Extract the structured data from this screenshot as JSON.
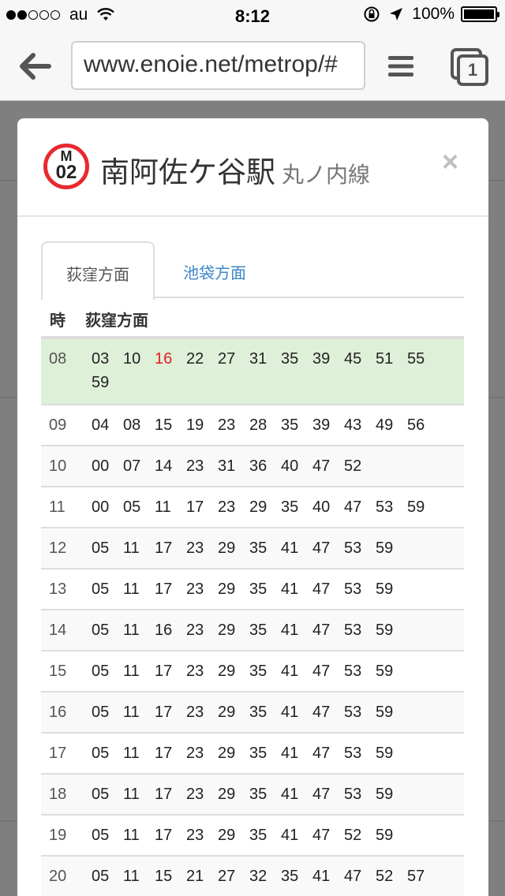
{
  "status_bar": {
    "carrier": "au",
    "time": "8:12",
    "battery": "100%"
  },
  "browser": {
    "url": "www.enoie.net/metrop/#",
    "tab_count": "1"
  },
  "modal": {
    "line_logo_letter": "M",
    "line_logo_number": "02",
    "line_color": "#e8292f",
    "station_name": "南阿佐ケ谷駅",
    "line_name": "丸ノ内線",
    "close_symbol": "×",
    "tabs": [
      {
        "label": "荻窪方面",
        "active": true
      },
      {
        "label": "池袋方面",
        "active": false
      }
    ],
    "table": {
      "col_hour": "時",
      "col_direction": "荻窪方面",
      "rows": [
        {
          "hour": "08",
          "minutes": [
            "03",
            "10",
            "16",
            "22",
            "27",
            "31",
            "35",
            "39",
            "45",
            "51",
            "55",
            "59"
          ],
          "highlight_minute": "16"
        },
        {
          "hour": "09",
          "minutes": [
            "04",
            "08",
            "15",
            "19",
            "23",
            "28",
            "35",
            "39",
            "43",
            "49",
            "56"
          ]
        },
        {
          "hour": "10",
          "minutes": [
            "00",
            "07",
            "14",
            "23",
            "31",
            "36",
            "40",
            "47",
            "52"
          ]
        },
        {
          "hour": "11",
          "minutes": [
            "00",
            "05",
            "11",
            "17",
            "23",
            "29",
            "35",
            "40",
            "47",
            "53",
            "59"
          ]
        },
        {
          "hour": "12",
          "minutes": [
            "05",
            "11",
            "17",
            "23",
            "29",
            "35",
            "41",
            "47",
            "53",
            "59"
          ]
        },
        {
          "hour": "13",
          "minutes": [
            "05",
            "11",
            "17",
            "23",
            "29",
            "35",
            "41",
            "47",
            "53",
            "59"
          ]
        },
        {
          "hour": "14",
          "minutes": [
            "05",
            "11",
            "16",
            "23",
            "29",
            "35",
            "41",
            "47",
            "53",
            "59"
          ]
        },
        {
          "hour": "15",
          "minutes": [
            "05",
            "11",
            "17",
            "23",
            "29",
            "35",
            "41",
            "47",
            "53",
            "59"
          ]
        },
        {
          "hour": "16",
          "minutes": [
            "05",
            "11",
            "17",
            "23",
            "29",
            "35",
            "41",
            "47",
            "53",
            "59"
          ]
        },
        {
          "hour": "17",
          "minutes": [
            "05",
            "11",
            "17",
            "23",
            "29",
            "35",
            "41",
            "47",
            "53",
            "59"
          ]
        },
        {
          "hour": "18",
          "minutes": [
            "05",
            "11",
            "17",
            "23",
            "29",
            "35",
            "41",
            "47",
            "53",
            "59"
          ]
        },
        {
          "hour": "19",
          "minutes": [
            "05",
            "11",
            "17",
            "23",
            "29",
            "35",
            "41",
            "47",
            "52",
            "59"
          ]
        },
        {
          "hour": "20",
          "minutes": [
            "05",
            "11",
            "15",
            "21",
            "27",
            "32",
            "35",
            "41",
            "47",
            "52",
            "57"
          ]
        }
      ]
    }
  }
}
